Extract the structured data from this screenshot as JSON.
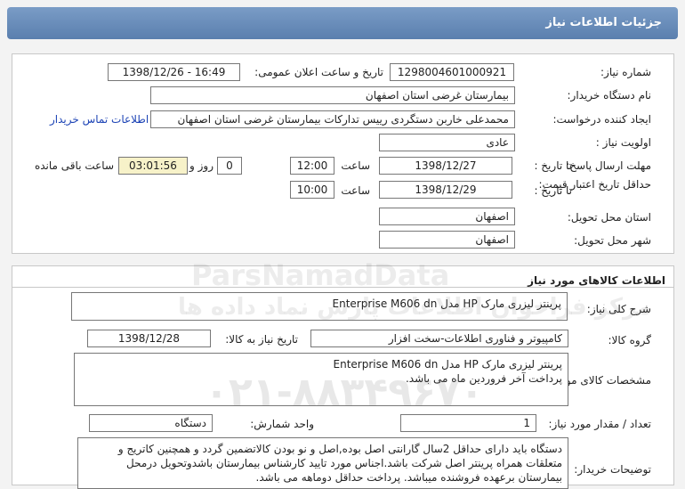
{
  "header": {
    "title": "جزئیات اطلاعات نیاز"
  },
  "info": {
    "need_number_label": "شماره نیاز:",
    "need_number": "1298004601000921",
    "announce_label": "تاریخ و ساعت اعلان عمومی:",
    "announce_value": "1398/12/26 - 16:49",
    "buyer_org_label": "نام دستگاه خریدار:",
    "buyer_org": "بیمارستان غرضی استان اصفهان",
    "requester_label": "ایجاد کننده درخواست:",
    "requester": "محمدعلی خاربن دستگردی رییس تدارکات بیمارستان غرضی استان اصفهان",
    "contact_link": "اطلاعات تماس خریدار",
    "priority_label": "اولویت نیاز :",
    "priority": "عادی",
    "deadline_label": "مهلت ارسال پاسخ:",
    "to_date_label": "تا تاریخ :",
    "deadline_date": "1398/12/27",
    "time_label": "ساعت",
    "deadline_time": "12:00",
    "days_value": "0",
    "days_label": "روز و",
    "remaining_time": "03:01:56",
    "remaining_label": "ساعت باقی مانده",
    "validity_label": "حداقل تاریخ اعتبار قیمت:",
    "validity_date": "1398/12/29",
    "validity_time": "10:00",
    "province_label": "استان محل تحویل:",
    "province": "اصفهان",
    "city_label": "شهر محل تحویل:",
    "city": "اصفهان"
  },
  "goods": {
    "section_title": "اطلاعات کالاهای مورد نیاز",
    "summary_label": "شرح کلی نیاز:",
    "summary": "پرینتر لیزری مارک HP مدل Enterprise M606 dn",
    "group_label": "گروه کالا:",
    "group": "کامپیوتر و فناوری اطلاعات-سخت افزار",
    "need_date_label": "تاریخ نیاز به کالا:",
    "need_date": "1398/12/28",
    "spec_label": "مشخصات کالای مورد نیاز:",
    "spec_line1": "پرینتر لیزری مارک HP مدل Enterprise M606 dn",
    "spec_line2": "پرداخت آخر فروردین ماه می باشد.",
    "qty_label": "تعداد / مقدار مورد نیاز:",
    "qty": "1",
    "unit_label": "واحد شمارش:",
    "unit": "دستگاه",
    "buyer_notes_label": "توضیحات خریدار:",
    "buyer_notes": "دستگاه باید دارای حداقل 2سال گارانتی اصل بوده,اصل و نو بودن کالاتضمین گردد و همچنین کاتریج و متعلقات همراه پرینتر اصل شرکت باشد.اجناس مورد تایید کارشناس بیمارستان باشدوتحویل درمحل بیمارستان برعهده فروشنده میباشد. پرداخت حداقل دوماهه می باشد."
  },
  "watermark": {
    "brand": "ParsNamadData",
    "persian": "مرکز فراخوان اطلاعات پارس نماد داده ها",
    "phone": "۰۲۱-۸۸۳۴۹۶۷۰"
  }
}
